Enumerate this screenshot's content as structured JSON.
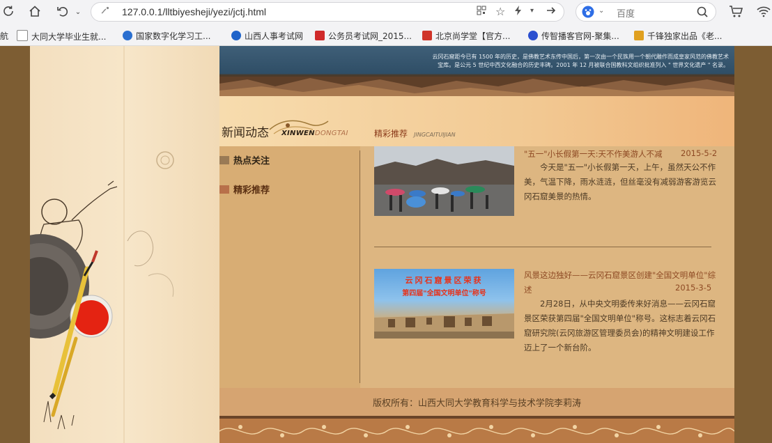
{
  "browser": {
    "url": "127.0.0.1/lltbiyesheji/yezi/jctj.html",
    "search_placeholder": "百度",
    "bookmarks": [
      {
        "label": "航",
        "color": "#666666"
      },
      {
        "label": "大同大学毕业生就...",
        "color": "#888888"
      },
      {
        "label": "国家数字化学习工...",
        "color": "#2a6fd0"
      },
      {
        "label": "山西人事考试网",
        "color": "#1f63c9"
      },
      {
        "label": "公务员考试网_2015...",
        "color": "#d02a2a"
      },
      {
        "label": "北京尚学堂【官方...",
        "color": "#d0352a"
      },
      {
        "label": "传智播客官网-聚集...",
        "color": "#2a4fd0"
      },
      {
        "label": "千锋独家出品《老...",
        "color": "#e0a020"
      }
    ],
    "icons": [
      "reload-icon",
      "home-icon",
      "undo-icon",
      "security-icon",
      "qr-icon",
      "star-icon",
      "lightning-icon",
      "chevron-down-icon",
      "forward-icon",
      "baidu-icon",
      "search-icon",
      "cart-icon",
      "wifi-icon"
    ]
  },
  "page": {
    "banner_text_line1": "云冈石窟距今已有 1500 年的历史，是佛教艺术东传中国后，第一次由一个民族用一个朝代雕作而成皇家风范的佛教艺术",
    "banner_text_line2": "宝库。是公元 5 世纪中西文化融合的历史丰碑。2001 年 12 月被联合国教科文组织批准列入 \" 世界文化遗产 \" 名录。",
    "section_title": "新闻动态",
    "section_title_en_a": "XINWEN",
    "section_title_en_b": "DONGTAI",
    "tab_title": "精彩推荐",
    "tab_title_en": "JINGCAITUIJIAN",
    "menu": [
      {
        "label": "热点关注",
        "color": "#9a7a55"
      },
      {
        "label": "精彩推荐",
        "color": "#b8704a"
      }
    ],
    "articles": [
      {
        "title": "\"五一\"小长假第一天:天不作美游人不减",
        "date": "2015-5-2",
        "body": "今天是\"五一\"小长假第一天，上午，虽然天公不作美，气温下降，雨水涟涟，但丝毫没有减弱游客游览云冈石窟美景的热情。"
      },
      {
        "title": "风景这边独好——云冈石窟景区创建\"全国文明单位\"综述",
        "date": "2015-3-5",
        "body": "2月28日，从中央文明委传来好消息——云冈石窟景区荣获第四届\"全国文明单位\"称号。这标志着云冈石窟研究院(云冈旅游区管理委员会)的精神文明建设工作迈上了一个新台阶。",
        "thumb_line1": "云冈石窟景区荣获",
        "thumb_line2": "第四届\"全国文明单位\"称号"
      }
    ],
    "footer": "版权所有：山西大同大学教育科学与技术学院李莉涛"
  }
}
